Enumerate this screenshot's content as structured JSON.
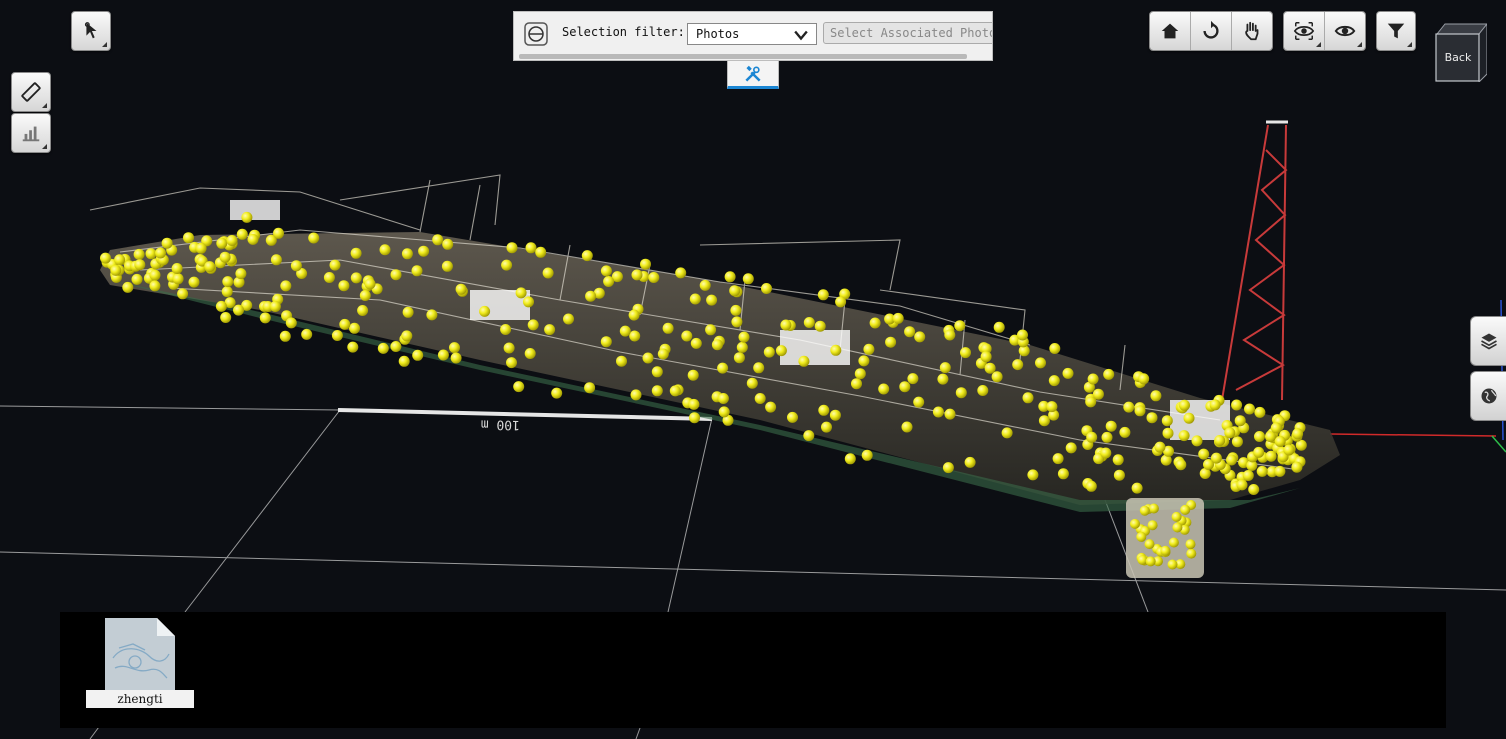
{
  "selection_filter": {
    "label": "Selection filter:",
    "selected": "Photos",
    "associated_button": "Select Associated Photos"
  },
  "scale_bar": {
    "label": "100 m"
  },
  "navigation_cube": {
    "face_label": "Back"
  },
  "file_panel": {
    "items": [
      {
        "name": "zhengti",
        "icon": "document-thumbnail-icon"
      }
    ]
  },
  "toolbar_left": [
    "select-pointer-icon",
    "measure-ruler-icon",
    "profile-chart-icon"
  ],
  "toolbar_right": [
    "home-icon",
    "orbit-icon",
    "pan-hand-icon",
    "look-around-icon",
    "visibility-eye-icon",
    "filter-funnel-icon"
  ],
  "side_panel": [
    "layers-icon",
    "globe-icon"
  ],
  "colors": {
    "background": "#0c0e13",
    "photo_marker": "#f2ee1e",
    "accent": "#1b86d3",
    "axis_red": "#d12a2a",
    "axis_green": "#2ebd4a",
    "axis_blue": "#2a52d1"
  }
}
